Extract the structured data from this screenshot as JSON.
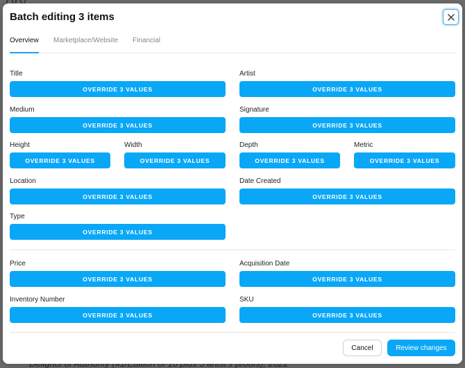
{
  "background": {
    "top_text": "ory",
    "bottom_text": "Delights of Authority (#1/Edition of 10 plus 3 artist's proofs), 2022"
  },
  "modal": {
    "title": "Batch editing 3 items",
    "close_icon": "close-icon"
  },
  "tabs": [
    {
      "label": "Overview",
      "active": true
    },
    {
      "label": "Marketplace/Website",
      "active": false
    },
    {
      "label": "Financial",
      "active": false
    }
  ],
  "fields": {
    "title": {
      "label": "Title",
      "button": "OVERRIDE 3 VALUES"
    },
    "artist": {
      "label": "Artist",
      "button": "OVERRIDE 3 VALUES"
    },
    "medium": {
      "label": "Medium",
      "button": "OVERRIDE 3 VALUES"
    },
    "signature": {
      "label": "Signature",
      "button": "OVERRIDE 3 VALUES"
    },
    "height": {
      "label": "Height",
      "button": "OVERRIDE 3 VALUES"
    },
    "width": {
      "label": "Width",
      "button": "OVERRIDE 3 VALUES"
    },
    "depth": {
      "label": "Depth",
      "button": "OVERRIDE 3 VALUES"
    },
    "metric": {
      "label": "Metric",
      "button": "OVERRIDE 3 VALUES"
    },
    "location": {
      "label": "Location",
      "button": "OVERRIDE 3 VALUES"
    },
    "date_created": {
      "label": "Date Created",
      "button": "OVERRIDE 3 VALUES"
    },
    "type": {
      "label": "Type",
      "button": "OVERRIDE 3 VALUES"
    },
    "price": {
      "label": "Price",
      "button": "OVERRIDE 3 VALUES"
    },
    "acquisition_date": {
      "label": "Acquisition Date",
      "button": "OVERRIDE 3 VALUES"
    },
    "inventory_number": {
      "label": "Inventory Number",
      "button": "OVERRIDE 3 VALUES"
    },
    "sku": {
      "label": "SKU",
      "button": "OVERRIDE 3 VALUES"
    }
  },
  "footer": {
    "cancel_label": "Cancel",
    "review_label": "Review changes"
  },
  "colors": {
    "accent": "#0aa7f7",
    "backdrop": "#6d6d6d"
  }
}
